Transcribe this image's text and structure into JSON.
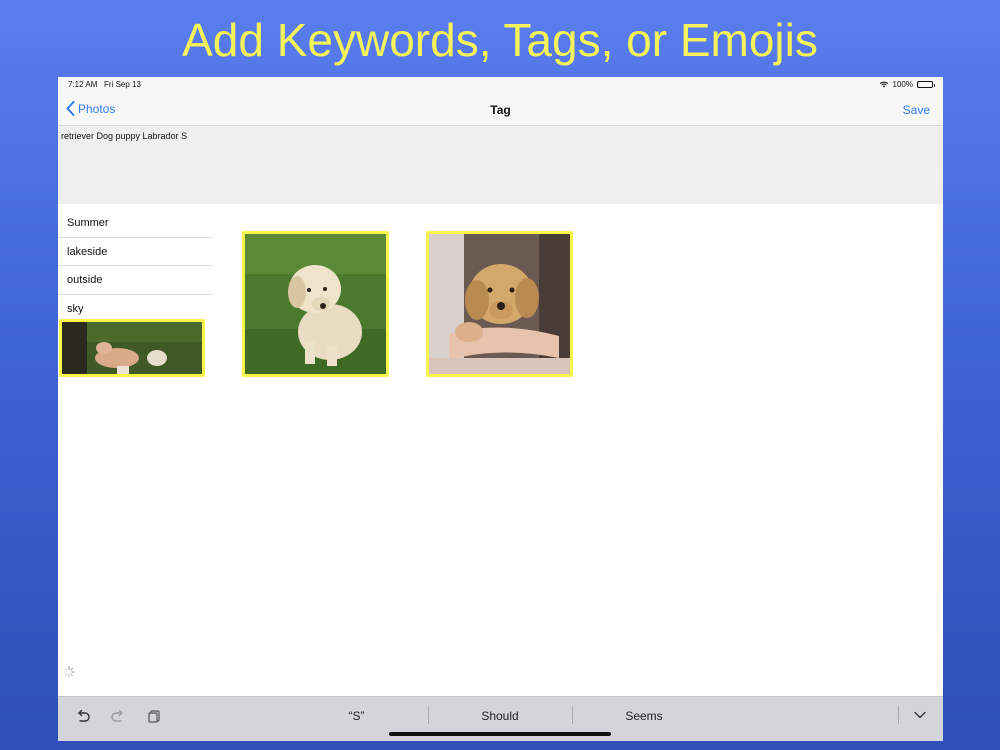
{
  "headline": "Add Keywords, Tags, or Emojis",
  "colors": {
    "accent": "#2f7bf6",
    "headline": "#f5f35a",
    "thumb_border": "#f7f54a"
  },
  "status_bar": {
    "time": "7:12 AM",
    "date": "Fri Sep 13",
    "battery": "100%"
  },
  "nav": {
    "back_label": "Photos",
    "title": "Tag",
    "save_label": "Save"
  },
  "tag_field": {
    "value": "retriever Dog puppy Labrador S"
  },
  "suggestions": [
    {
      "label": "Summer"
    },
    {
      "label": "lakeside"
    },
    {
      "label": "outside"
    },
    {
      "label": "sky"
    }
  ],
  "keyboard": {
    "predictions": [
      "“S”",
      "Should",
      "Seems"
    ],
    "icons": [
      "undo-icon",
      "redo-icon",
      "paste-icon",
      "dismiss-keyboard-icon"
    ]
  }
}
